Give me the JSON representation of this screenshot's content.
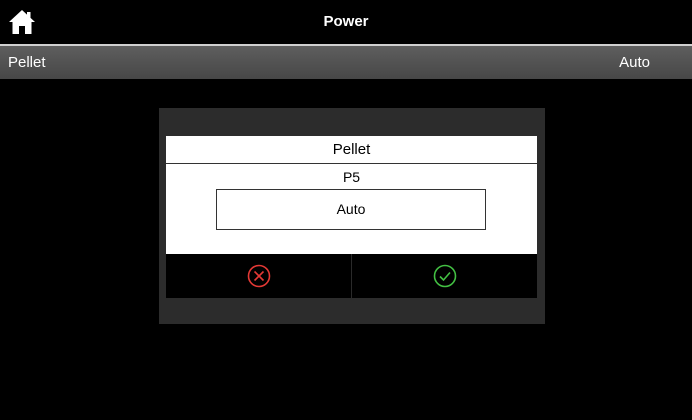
{
  "header": {
    "title": "Power",
    "home_icon": "home-icon"
  },
  "setting_row": {
    "label": "Pellet",
    "value": "Auto"
  },
  "dialog": {
    "title": "Pellet",
    "subtitle": "P5",
    "value": "Auto",
    "cancel_icon": "cancel-icon",
    "confirm_icon": "confirm-icon"
  },
  "colors": {
    "cancel": "#e53935",
    "confirm": "#43c043",
    "row_background": "#555555"
  }
}
